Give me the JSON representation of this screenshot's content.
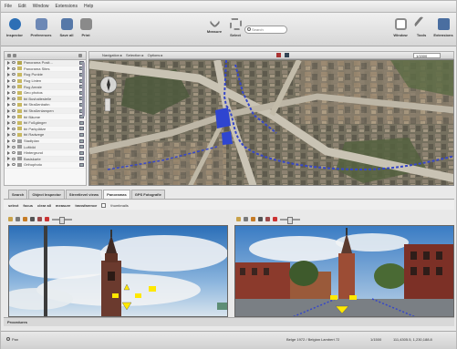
{
  "menu": [
    "File",
    "Edit",
    "Window",
    "Extensions",
    "Help"
  ],
  "toolbar": {
    "left": [
      {
        "label": "Inspector",
        "icon": "info-icon",
        "color": "#2d6fb5"
      },
      {
        "label": "Preferences",
        "icon": "preferences-icon",
        "color": "#6d88b5"
      },
      {
        "label": "Save all",
        "icon": "save-icon",
        "color": "#5678a8"
      },
      {
        "label": "Print",
        "icon": "print-icon",
        "color": "#8a8a8a"
      }
    ],
    "center": [
      {
        "label": "Measure",
        "icon": "measure-icon",
        "color": "#777777"
      },
      {
        "label": "Select",
        "icon": "select-icon",
        "color": "#888888"
      }
    ],
    "search_placeholder": "Search",
    "right": [
      {
        "label": "Window",
        "icon": "window-icon",
        "color": "#8a8a8a"
      },
      {
        "label": "Tools",
        "icon": "tools-icon",
        "color": "#7a7a7a"
      },
      {
        "label": "Extensions",
        "icon": "extensions-icon",
        "color": "#4a6ea0"
      }
    ]
  },
  "layers": [
    {
      "label": "Panorama Posit...",
      "icon_color": "#b4a650"
    },
    {
      "label": "Panorama Sites",
      "icon_color": "#c8b860"
    },
    {
      "label": "Rug Punkte",
      "icon_color": "#c8b860"
    },
    {
      "label": "Rug Linien",
      "icon_color": "#c8b860"
    },
    {
      "label": "Rug Areale",
      "icon_color": "#c8b860"
    },
    {
      "label": "Geo photos",
      "icon_color": "#c8b860"
    },
    {
      "label": "tbl Bushaltestelle",
      "icon_color": "#c8b860"
    },
    {
      "label": "tbl Straßenbahn",
      "icon_color": "#c8b860"
    },
    {
      "label": "tbl Straßenlampen",
      "icon_color": "#c8b860"
    },
    {
      "label": "tbl Bäume",
      "icon_color": "#c8b860"
    },
    {
      "label": "tbl Fußgänger",
      "icon_color": "#c8b860"
    },
    {
      "label": "tbl Parkplätze",
      "icon_color": "#c8b860"
    },
    {
      "label": "tbl Radwege",
      "icon_color": "#c8b860"
    },
    {
      "label": "Stadtplan",
      "icon_color": "#9a9a9a"
    },
    {
      "label": "Luftbild",
      "icon_color": "#9a9a9a"
    },
    {
      "label": "Hintergrund",
      "icon_color": "#9a9a9a"
    },
    {
      "label": "Basiskarte",
      "icon_color": "#9a9a9a"
    },
    {
      "label": "Orthophoto",
      "icon_color": "#9a9a9a"
    }
  ],
  "map_toolbar": {
    "items": [
      "Navigation ▸",
      "Selection ▸",
      "Options ▸"
    ],
    "scale": "1/1500"
  },
  "tabs": [
    "Search",
    "Object Inspector",
    "Streetlevel views",
    "Panoramas",
    "GPS Fotografie"
  ],
  "active_tab": 3,
  "subbar": {
    "items": [
      "select",
      "focus",
      "clear all",
      "measure",
      "transfarence"
    ],
    "checkbox_label": "thumbnails"
  },
  "pano_bar_label": "Procedures",
  "status": {
    "left": "Pan",
    "crs": "Belge 1972 / Belgian Lambert 72",
    "scale": "1/1500",
    "coords": "111,4305.5, 1,230,188.8"
  }
}
